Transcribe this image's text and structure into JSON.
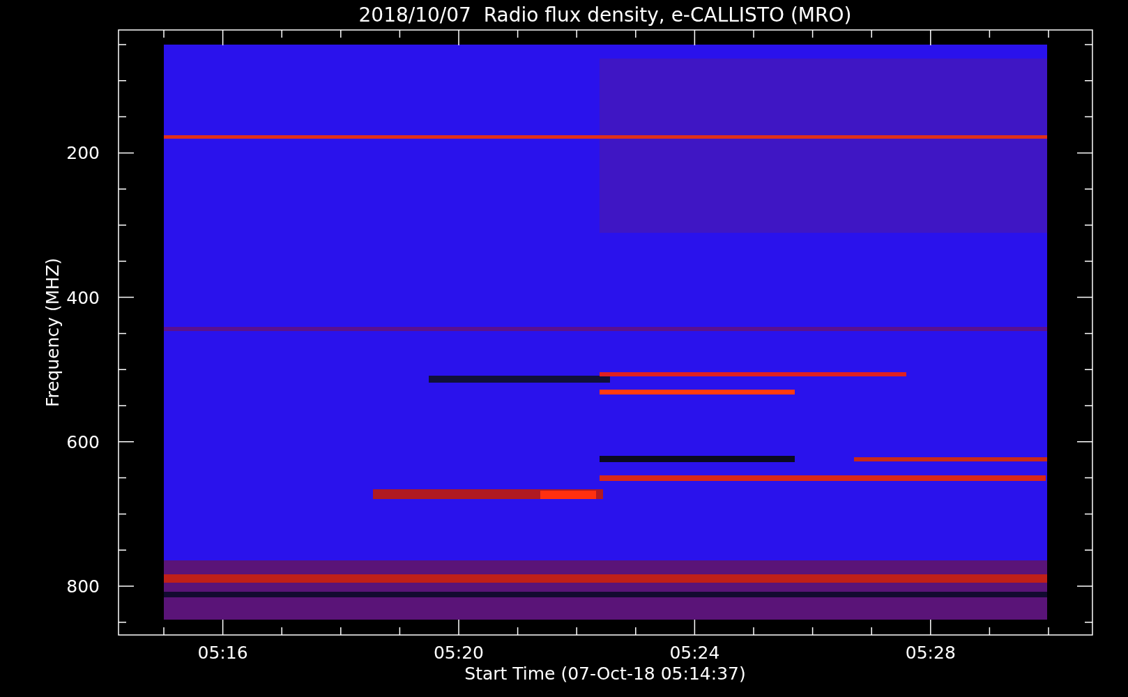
{
  "title": "2018/10/07  Radio flux density, e-CALLISTO (MRO)",
  "y_axis": {
    "label": "Frequency (MHZ)",
    "ticks": [
      "200",
      "400",
      "600",
      "800"
    ]
  },
  "x_axis": {
    "label": "Start Time (07-Oct-18 05:14:37)",
    "ticks": [
      "05:16",
      "05:20",
      "05:24",
      "05:28"
    ]
  }
}
